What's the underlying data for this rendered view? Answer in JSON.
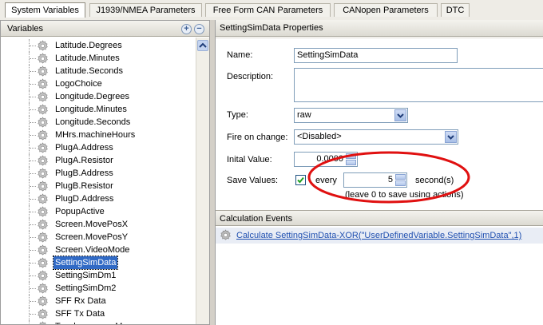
{
  "tabs": [
    {
      "label": "System Variables",
      "active": true
    },
    {
      "label": "J1939/NMEA Parameters",
      "active": false
    },
    {
      "label": "Free Form CAN Parameters",
      "active": false
    },
    {
      "label": "CANopen Parameters",
      "active": false
    },
    {
      "label": "DTC",
      "active": false
    }
  ],
  "variables_panel": {
    "title": "Variables",
    "items": [
      {
        "label": "Latitude.Degrees",
        "selected": false
      },
      {
        "label": "Latitude.Minutes",
        "selected": false
      },
      {
        "label": "Latitude.Seconds",
        "selected": false
      },
      {
        "label": "LogoChoice",
        "selected": false
      },
      {
        "label": "Longitude.Degrees",
        "selected": false
      },
      {
        "label": "Longitude.Minutes",
        "selected": false
      },
      {
        "label": "Longitude.Seconds",
        "selected": false
      },
      {
        "label": "MHrs.machineHours",
        "selected": false
      },
      {
        "label": "PlugA.Address",
        "selected": false
      },
      {
        "label": "PlugA.Resistor",
        "selected": false
      },
      {
        "label": "PlugB.Address",
        "selected": false
      },
      {
        "label": "PlugB.Resistor",
        "selected": false
      },
      {
        "label": "PlugD.Address",
        "selected": false
      },
      {
        "label": "PopupActive",
        "selected": false
      },
      {
        "label": "Screen.MovePosX",
        "selected": false
      },
      {
        "label": "Screen.MovePosY",
        "selected": false
      },
      {
        "label": "Screen.VideoMode",
        "selected": false
      },
      {
        "label": "SettingSimData",
        "selected": true
      },
      {
        "label": "SettingSimDm1",
        "selected": false
      },
      {
        "label": "SettingSimDm2",
        "selected": false
      },
      {
        "label": "SFF Rx Data",
        "selected": false
      },
      {
        "label": "SFF Tx Data",
        "selected": false
      },
      {
        "label": "Toucheau...ar...M...",
        "selected": false
      }
    ]
  },
  "properties": {
    "title": "SettingSimData Properties",
    "name_label": "Name:",
    "name_value": "SettingSimData",
    "description_label": "Description:",
    "description_value": "",
    "type_label": "Type:",
    "type_value": "raw",
    "fire_label": "Fire on change:",
    "fire_value": "<Disabled>",
    "initial_label": "Inital Value:",
    "initial_value": "0.0000",
    "save_label": "Save Values:",
    "save_checked": true,
    "every_label": "every",
    "every_value": "5",
    "seconds_label": "second(s)",
    "hint": "(leave 0 to save using actions)"
  },
  "calculation": {
    "title": "Calculation Events",
    "event": "Calculate SettingSimData-XOR(\"UserDefinedVariable.SettingSimData\",1)"
  },
  "colors": {
    "selection": "#316ac5",
    "highlight_ellipse": "#e01010",
    "link": "#1f4fb0"
  }
}
